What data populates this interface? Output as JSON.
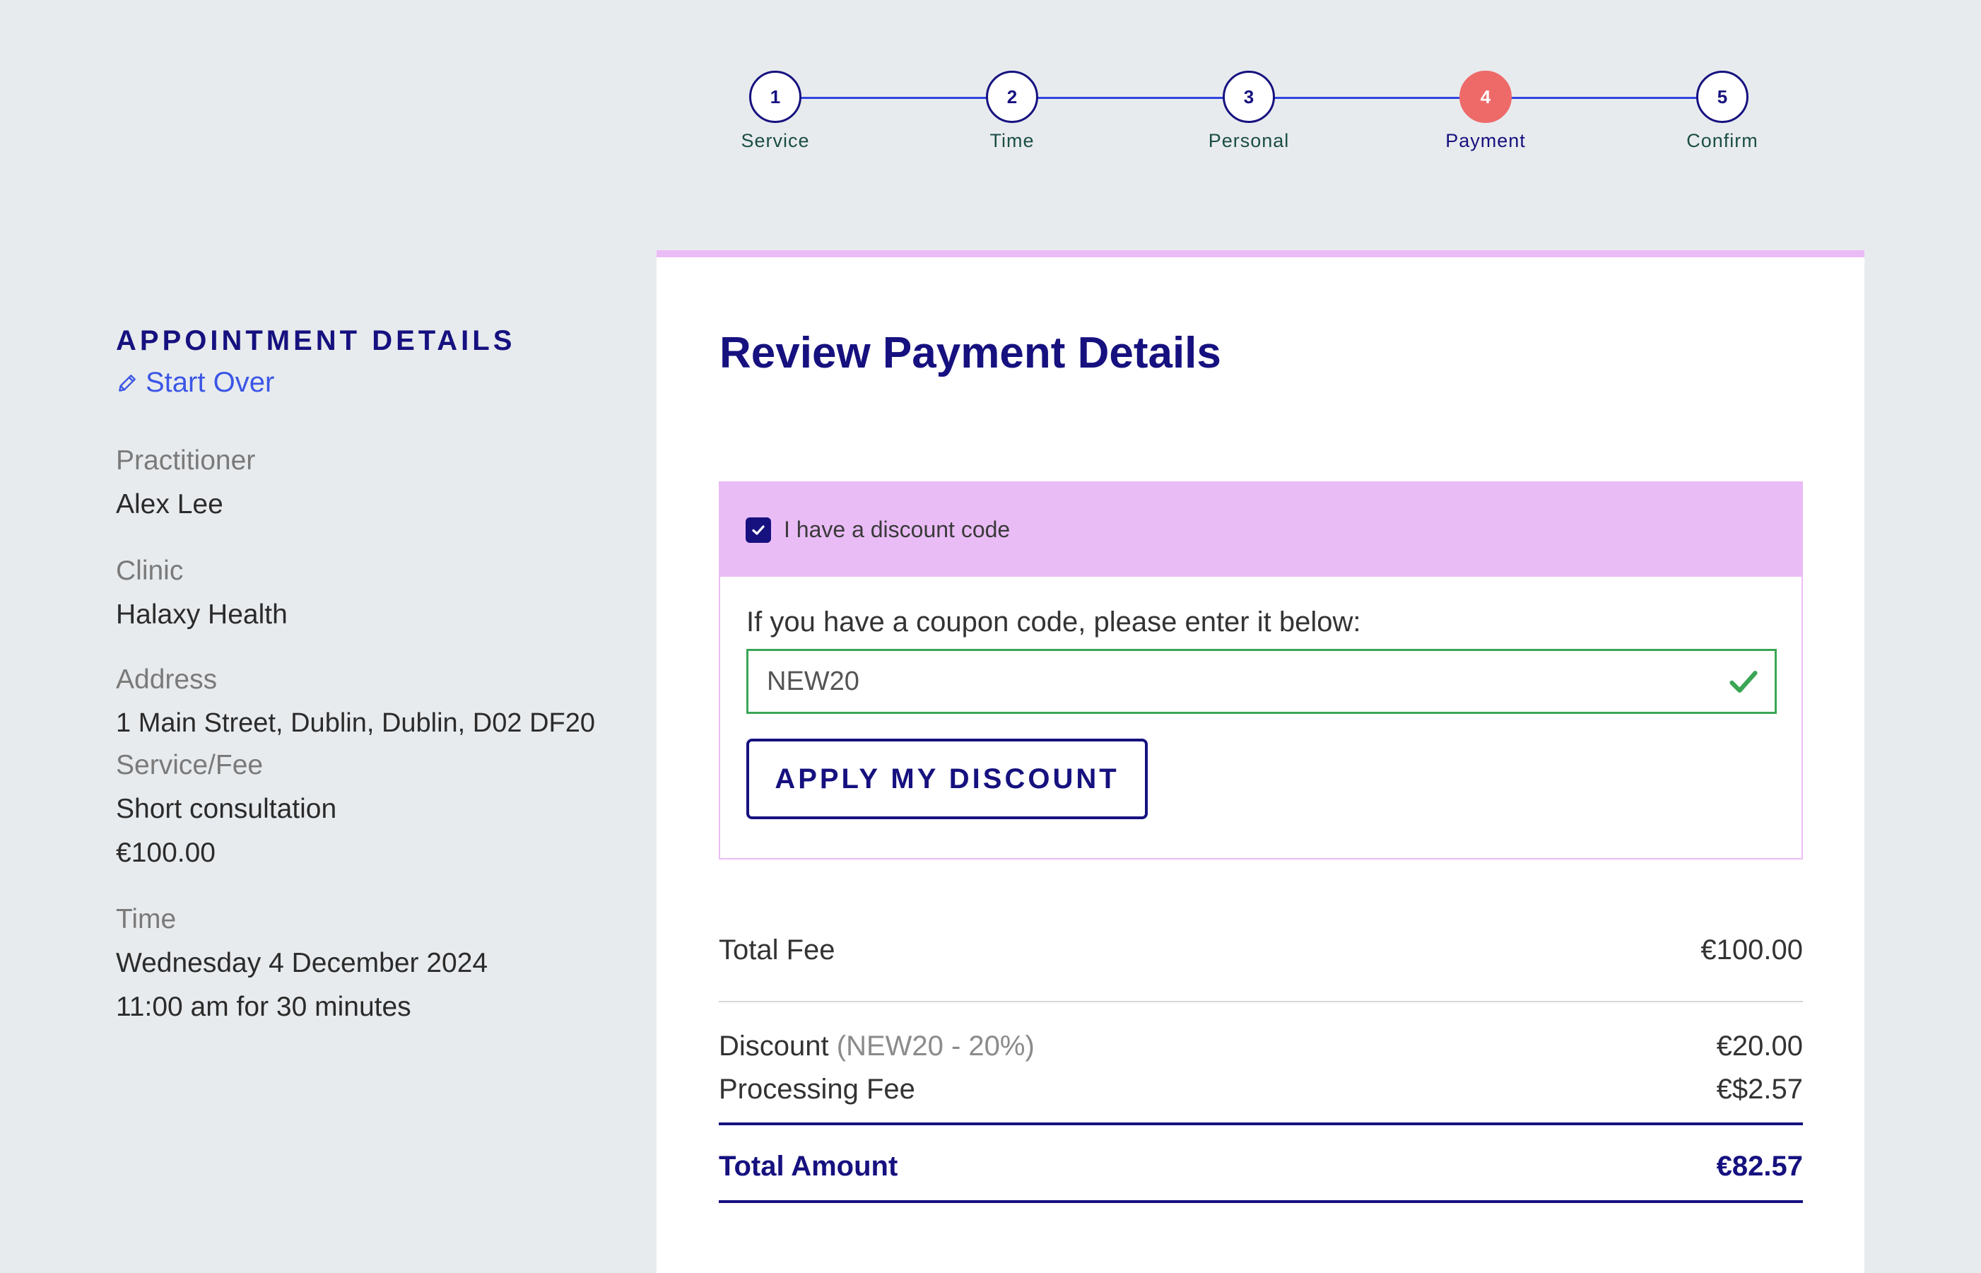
{
  "stepper": {
    "steps": [
      {
        "number": "1",
        "label": "Service"
      },
      {
        "number": "2",
        "label": "Time"
      },
      {
        "number": "3",
        "label": "Personal"
      },
      {
        "number": "4",
        "label": "Payment"
      },
      {
        "number": "5",
        "label": "Confirm"
      }
    ],
    "active_step": 4
  },
  "appointment": {
    "title": "APPOINTMENT DETAILS",
    "start_over": "Start Over",
    "practitioner_label": "Practitioner",
    "practitioner": "Alex Lee",
    "clinic_label": "Clinic",
    "clinic": "Halaxy Health",
    "address_label": "Address",
    "address": "1 Main Street, Dublin, Dublin, D02 DF20",
    "service_label": "Service/Fee",
    "service": "Short consultation",
    "service_fee": "€100.00",
    "time_label": "Time",
    "date": "Wednesday 4 December 2024",
    "time": "11:00 am for 30 minutes"
  },
  "payment": {
    "title": "Review Payment Details",
    "discount_checkbox_label": "I have a discount code",
    "discount_checked": true,
    "coupon_prompt": "If you have a coupon code, please enter it below:",
    "coupon_value": "NEW20",
    "apply_button": "APPLY MY DISCOUNT",
    "total_fee_label": "Total Fee",
    "total_fee": "€100.00",
    "discount_label": "Discount",
    "discount_note": "(NEW20 - 20%)",
    "discount_amount": "€20.00",
    "processing_label": "Processing Fee",
    "processing_amount": "€$2.57",
    "total_amount_label": "Total Amount",
    "total_amount": "€82.57"
  },
  "colors": {
    "primary": "#16117f",
    "accent": "#ed6a69",
    "link": "#3b56e6",
    "highlight": "#eabcf6",
    "valid": "#3aa655"
  },
  "icons": {
    "start_over": "pencil-icon",
    "checkbox": "checkmark-icon",
    "coupon_valid": "checkmark-icon"
  }
}
